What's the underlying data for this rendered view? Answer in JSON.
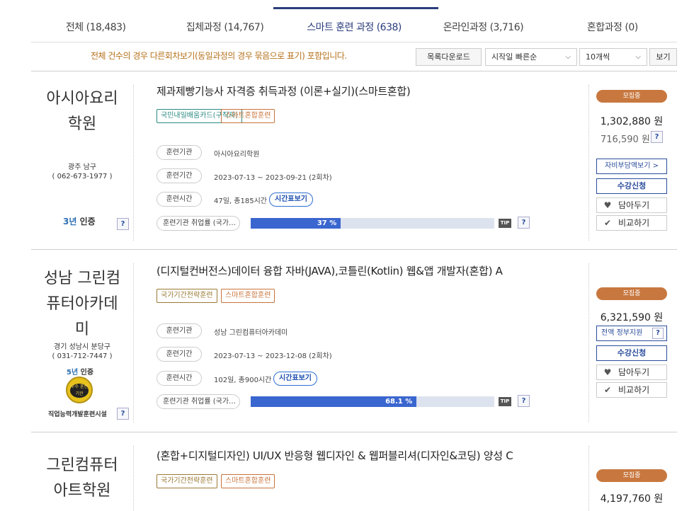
{
  "tabs": [
    {
      "label": "전체 (18,483)"
    },
    {
      "label": "집체과정 (14,767)"
    },
    {
      "label": "스마트 훈련 과정 (638)"
    },
    {
      "label": "온라인과정 (3,716)"
    },
    {
      "label": "혼합과정 (0)"
    }
  ],
  "active_tab_index": 2,
  "notice": "전체 건수의 경우 다른회차보기(동일과정의 경우 묶음으로 표기) 포함입니다.",
  "toolbar": {
    "download_label": "목록다운로드",
    "sort_value": "시작일 빠른순",
    "page_size_value": "10개씩",
    "view_label": "보기"
  },
  "courses": [
    {
      "institution_name": "아시아요리\n학원",
      "location": "광주 남구",
      "phone": "( 062-673-1977 )",
      "cert_years": "3년",
      "cert_label": "인증",
      "title": "제과제빵기능사 자격증 취득과정 (이론+실기)(스마트혼합)",
      "tags": [
        "국민내일배움카드(구직자)",
        "스마트혼합훈련"
      ],
      "labels": {
        "org": "훈련기관",
        "period": "훈련기간",
        "time": "훈련시간",
        "employment": "훈련기관 취업률 (국가…"
      },
      "org": "아시아요리학원",
      "period": "2023-07-13 ~ 2023-09-21 (2회차)",
      "time": "47일, 총185시간",
      "timetable_label": "시간표보기",
      "employment_rate": 37,
      "employment_rate_text": "37 %",
      "tip": "TIP",
      "status": "모집중",
      "price": "1,302,880 원",
      "price2": "716,590 원",
      "self_pay_label": "자비부담액보기 >",
      "apply_label": "수강신청",
      "wish_label": "담아두기",
      "compare_label": "비교하기"
    },
    {
      "institution_name": "성남 그린컴\n퓨터아카데\n미",
      "location": "경기 성남시 분당구",
      "phone": "( 031-712-7447 )",
      "cert_years": "5년",
      "cert_label": "인증",
      "seal_text": "우수 훈련기관",
      "facility_label": "직업능력개발훈련시설",
      "title": "(디지털컨버전스)데이터 융합 자바(JAVA),코틀린(Kotlin) 웹&앱 개발자(혼합) A",
      "tags": [
        "국가기간전략훈련",
        "스마트혼합훈련"
      ],
      "labels": {
        "org": "훈련기관",
        "period": "훈련기간",
        "time": "훈련시간",
        "employment": "훈련기관 취업률 (국가…"
      },
      "org": "성남 그린컴퓨터아카데미",
      "period": "2023-07-13 ~ 2023-12-08 (2회차)",
      "time": "102일, 총900시간",
      "timetable_label": "시간표보기",
      "employment_rate": 68.1,
      "employment_rate_text": "68.1 %",
      "tip": "TIP",
      "status": "모집중",
      "price": "6,321,590 원",
      "gov_label": "전액 정부지원",
      "apply_label": "수강신청",
      "wish_label": "담아두기",
      "compare_label": "비교하기"
    },
    {
      "institution_name": "그린컴퓨터\n아트학원",
      "title": "(혼합+디지털디자인) UI/UX 반응형 웹디자인 & 웹퍼블리셔(디자인&코딩) 양성 C",
      "tags": [
        "국가기간전략훈련",
        "스마트혼합훈련"
      ],
      "status": "모집중",
      "price": "4,197,760 원"
    }
  ],
  "icons": {
    "question": "?",
    "heart": "♥",
    "check": "✔",
    "chevron": "⌵"
  },
  "colors": {
    "accent": "#2a3d7c",
    "status": "#c8783f",
    "bar": "#3a66cf",
    "notice": "#b5711b"
  }
}
